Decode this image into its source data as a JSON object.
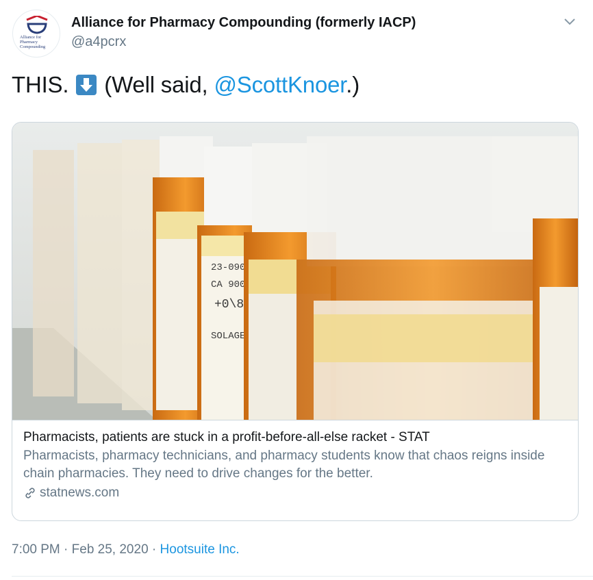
{
  "header": {
    "name": "Alliance for Pharmacy Compounding (formerly IACP)",
    "handle": "@a4pcrx",
    "avatar_text": "Alliance for Pharmacy Compounding"
  },
  "tweet": {
    "text_before": "THIS.",
    "emoji": "down-arrow-emoji",
    "text_mid": " (Well said, ",
    "mention": "@ScottKnoer",
    "text_after": ".)"
  },
  "card": {
    "image": "pill-bottles-photo",
    "title": "Pharmacists, patients are stuck in a profit-before-all-else racket - STAT",
    "description": "Pharmacists, pharmacy technicians, and pharmacy students know that chaos reigns inside chain pharmacies. They need to drive changes for the better.",
    "domain": "statnews.com"
  },
  "meta": {
    "time": "7:00 PM",
    "separator": " · ",
    "date": "Feb 25, 2020",
    "source": "Hootsuite Inc."
  },
  "colors": {
    "link": "#1b95e0",
    "secondary": "#657786",
    "border": "#ccd6dd",
    "emoji_bg": "#3b88c3"
  }
}
